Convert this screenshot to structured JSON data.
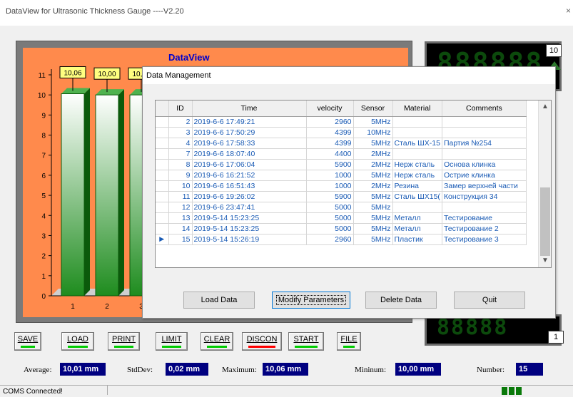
{
  "window": {
    "title": "DataView  for Ultrasonic Thickness Gauge ----V2.20",
    "close_glyph": "×"
  },
  "chart_data": {
    "type": "bar",
    "title": "DataView",
    "categories": [
      "1",
      "2",
      "3"
    ],
    "values": [
      10.06,
      10.0,
      10.0
    ],
    "value_labels": [
      "10,06",
      "10,00",
      "10,00"
    ],
    "y_ticks": [
      "0",
      "1",
      "2",
      "3",
      "4",
      "5",
      "6",
      "7",
      "8",
      "9",
      "10",
      "11"
    ],
    "ylim": [
      0,
      11
    ],
    "colors": {
      "panel": "#ff8a4c",
      "bar": "#1e8c1e",
      "label_bg": "#ffff80"
    }
  },
  "lcd": {
    "top_digits": "888888",
    "top_badge": "10",
    "bottom_digits": "88888",
    "bottom_badge": "1"
  },
  "dialog": {
    "title": "Data Management",
    "columns": [
      "ID",
      "Time",
      "velocity",
      "Sensor",
      "Material",
      "Comments"
    ],
    "rows": [
      {
        "id": "2",
        "time": "2019-6-6 17:49:21",
        "velocity": "2960",
        "sensor": "5MHz",
        "material": "",
        "comments": ""
      },
      {
        "id": "3",
        "time": "2019-6-6 17:50:29",
        "velocity": "4399",
        "sensor": "10MHz",
        "material": "",
        "comments": ""
      },
      {
        "id": "4",
        "time": "2019-6-6 17:58:33",
        "velocity": "4399",
        "sensor": "5MHz",
        "material": "Сталь ШХ-15",
        "comments": "Партия №254"
      },
      {
        "id": "7",
        "time": "2019-6-6 18:07:40",
        "velocity": "4400",
        "sensor": "2MHz",
        "material": "",
        "comments": ""
      },
      {
        "id": "8",
        "time": "2019-6-6 17:06:04",
        "velocity": "5900",
        "sensor": "2MHz",
        "material": "Нерж сталь",
        "comments": "Основа клинка"
      },
      {
        "id": "9",
        "time": "2019-6-6 16:21:52",
        "velocity": "1000",
        "sensor": "5MHz",
        "material": "Нерж сталь",
        "comments": "Острие клинка"
      },
      {
        "id": "10",
        "time": "2019-6-6 16:51:43",
        "velocity": "1000",
        "sensor": "2MHz",
        "material": "Резина",
        "comments": "Замер верхней части"
      },
      {
        "id": "11",
        "time": "2019-6-6 19:26:02",
        "velocity": "5900",
        "sensor": "5MHz",
        "material": "Сталь ШХ15(",
        "comments": "Конструкция 34"
      },
      {
        "id": "12",
        "time": "2019-6-6 23:47:41",
        "velocity": "5000",
        "sensor": "5MHz",
        "material": "",
        "comments": ""
      },
      {
        "id": "13",
        "time": "2019-5-14 15:23:25",
        "velocity": "5000",
        "sensor": "5MHz",
        "material": "Металл",
        "comments": "Тестирование"
      },
      {
        "id": "14",
        "time": "2019-5-14 15:23:25",
        "velocity": "5000",
        "sensor": "5MHz",
        "material": "Металл",
        "comments": "Тестирование 2"
      },
      {
        "id": "15",
        "time": "2019-5-14 15:26:19",
        "velocity": "2960",
        "sensor": "5MHz",
        "material": "Пластик",
        "comments": "Тестирование 3",
        "current": true
      }
    ],
    "buttons": {
      "load": "Load Data",
      "modify": "Modify Parameters",
      "delete": "Delete Data",
      "quit": "Quit"
    }
  },
  "toolbar": [
    {
      "key": "save",
      "label": "SAVE",
      "bar": "green"
    },
    {
      "key": "load",
      "label": "LOAD",
      "bar": "green"
    },
    {
      "key": "print",
      "label": "PRINT",
      "bar": "green"
    },
    {
      "key": "limit",
      "label": "LIMIT",
      "bar": "green"
    },
    {
      "key": "clear",
      "label": "CLEAR",
      "bar": "green"
    },
    {
      "key": "discon",
      "label": "DISCON",
      "bar": "red"
    },
    {
      "key": "start",
      "label": "START",
      "bar": "green"
    },
    {
      "key": "file",
      "label": "FILE",
      "bar": "green"
    }
  ],
  "stats": {
    "average_label": "Average:",
    "average": "10,01 mm",
    "stddev_label": "StdDev:",
    "stddev": "0,02 mm",
    "maximum_label": "Maximum:",
    "maximum": "10,06 mm",
    "minimum_label": "Mininum:",
    "minimum": "10,00 mm",
    "number_label": "Number:",
    "number": "15"
  },
  "status": {
    "text": "COMS Connected!"
  }
}
